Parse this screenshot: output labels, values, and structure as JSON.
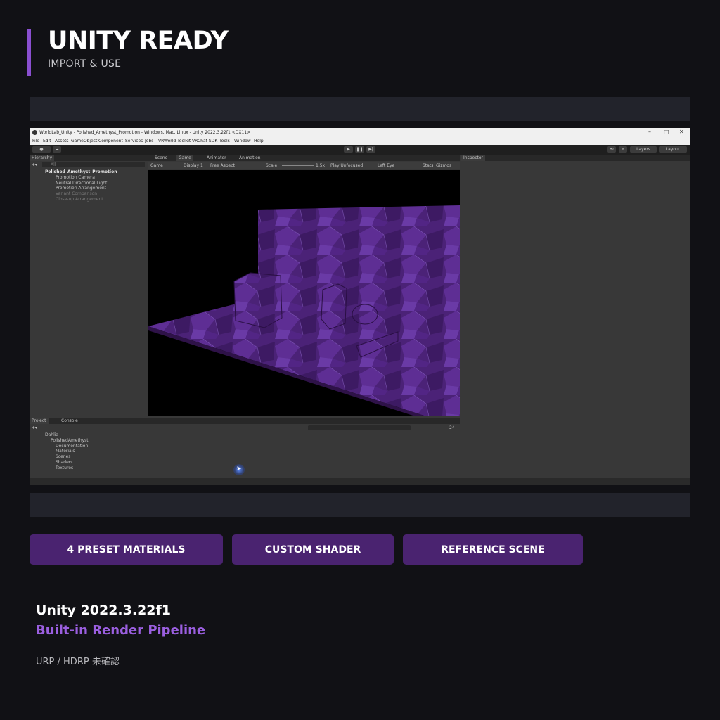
{
  "header": {
    "title": "UNITY READY",
    "subtitle": "IMPORT & USE",
    "accent_color": "#8a4fd0"
  },
  "unity_window": {
    "title": "WorldLab_Unity - Polished_Amethyst_Promotion - Windows, Mac, Linux - Unity 2022.3.22f1 <DX11>",
    "menu": [
      "File",
      "Edit",
      "Assets",
      "GameObject",
      "Component",
      "Services",
      "Jobs",
      "VRWorld Toolkit",
      "VRChat SDK",
      "Tools",
      "Window",
      "Help"
    ],
    "toolbar": {
      "layers_label": "Layers",
      "layout_label": "Layout"
    },
    "hierarchy": {
      "tab": "Hierarchy",
      "search_placeholder": "All",
      "scene": "Polished_Amethyst_Promotion",
      "items": [
        "Promotion Camera",
        "Neutral Directional Light",
        "Promotion Arrangement",
        "Variant Comparison",
        "Close-up Arrangement"
      ]
    },
    "center_tabs": [
      "Scene",
      "Game",
      "Animator",
      "Animation"
    ],
    "game_toolbar": {
      "display_mode": "Game",
      "display": "Display 1",
      "aspect": "Free Aspect",
      "scale_label": "Scale",
      "scale_value": "1.5x",
      "play_mode": "Play Unfocused",
      "eye": "Left Eye",
      "stats": "Stats",
      "gizmos": "Gizmos"
    },
    "inspector": {
      "tab": "Inspector"
    },
    "project": {
      "tabs": [
        "Project",
        "Console"
      ],
      "count": "24",
      "tree": [
        "Dahlia",
        "PolishedAmethyst",
        "Documentation",
        "Materials",
        "Scenes",
        "Shaders",
        "Textures"
      ]
    }
  },
  "features": {
    "presets": "4 PRESET MATERIALS",
    "shader": "CUSTOM SHADER",
    "scene": "REFERENCE SCENE",
    "button_color": "#4a2370"
  },
  "info": {
    "version": "Unity 2022.3.22f1",
    "pipeline": "Built-in Render Pipeline",
    "note": "URP / HDRP 未確認",
    "pipeline_color": "#9b5fe0"
  }
}
